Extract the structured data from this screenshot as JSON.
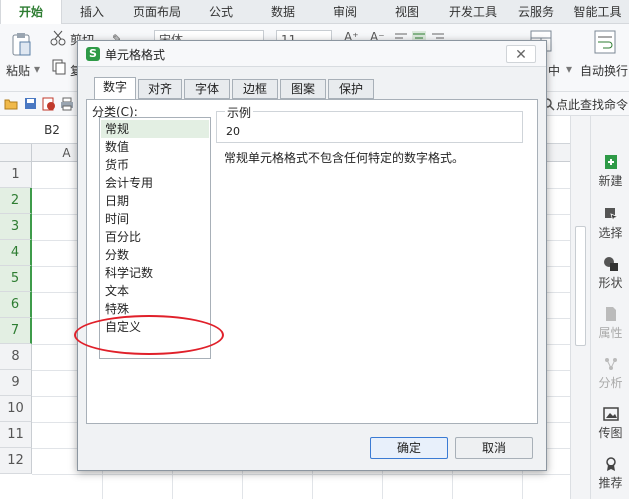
{
  "ribbon_tabs": [
    "开始",
    "插入",
    "页面布局",
    "公式",
    "数据",
    "审阅",
    "视图",
    "开发工具",
    "云服务",
    "智能工具"
  ],
  "ribbon": {
    "cut": "剪切",
    "paste": "粘贴",
    "copy_partial": "复",
    "font_value": "宋体",
    "font_size": "11",
    "merge_partial": "中",
    "auto_wrap": "自动换行",
    "find_command": "点此查找命令"
  },
  "formula_bar": {
    "name_box": "B2"
  },
  "grid": {
    "columns": [
      "A"
    ],
    "rows": [
      "1",
      "2",
      "3",
      "4",
      "5",
      "6",
      "7",
      "8",
      "9",
      "10",
      "11",
      "12"
    ],
    "selected_rows": [
      "2",
      "3",
      "4",
      "5",
      "6",
      "7"
    ]
  },
  "right_panel": {
    "items": [
      {
        "label": "新建",
        "enabled": true,
        "icon": "new-icon"
      },
      {
        "label": "选择",
        "enabled": true,
        "icon": "select-icon"
      },
      {
        "label": "形状",
        "enabled": true,
        "icon": "shape-icon"
      },
      {
        "label": "属性",
        "enabled": false,
        "icon": "properties-icon"
      },
      {
        "label": "分析",
        "enabled": false,
        "icon": "analysis-icon"
      },
      {
        "label": "传图",
        "enabled": true,
        "icon": "upload-image-icon"
      },
      {
        "label": "推荐",
        "enabled": true,
        "icon": "recommend-icon"
      }
    ]
  },
  "dialog": {
    "logo": "S",
    "title": "单元格格式",
    "close": "✕",
    "tabs": [
      "数字",
      "对齐",
      "字体",
      "边框",
      "图案",
      "保护"
    ],
    "category_label": "分类(C):",
    "categories": [
      "常规",
      "数值",
      "货币",
      "会计专用",
      "日期",
      "时间",
      "百分比",
      "分数",
      "科学记数",
      "文本",
      "特殊",
      "自定义"
    ],
    "selected_category": "常规",
    "sample_label": "示例",
    "sample_value": "20",
    "description": "常规单元格格式不包含任何特定的数字格式。",
    "ok": "确定",
    "cancel": "取消"
  },
  "colors": {
    "accent_green": "#2e7d32",
    "selection_green": "#e3efe3",
    "annotation_red": "#e0202a",
    "primary_button_border": "#3b7bd4"
  }
}
